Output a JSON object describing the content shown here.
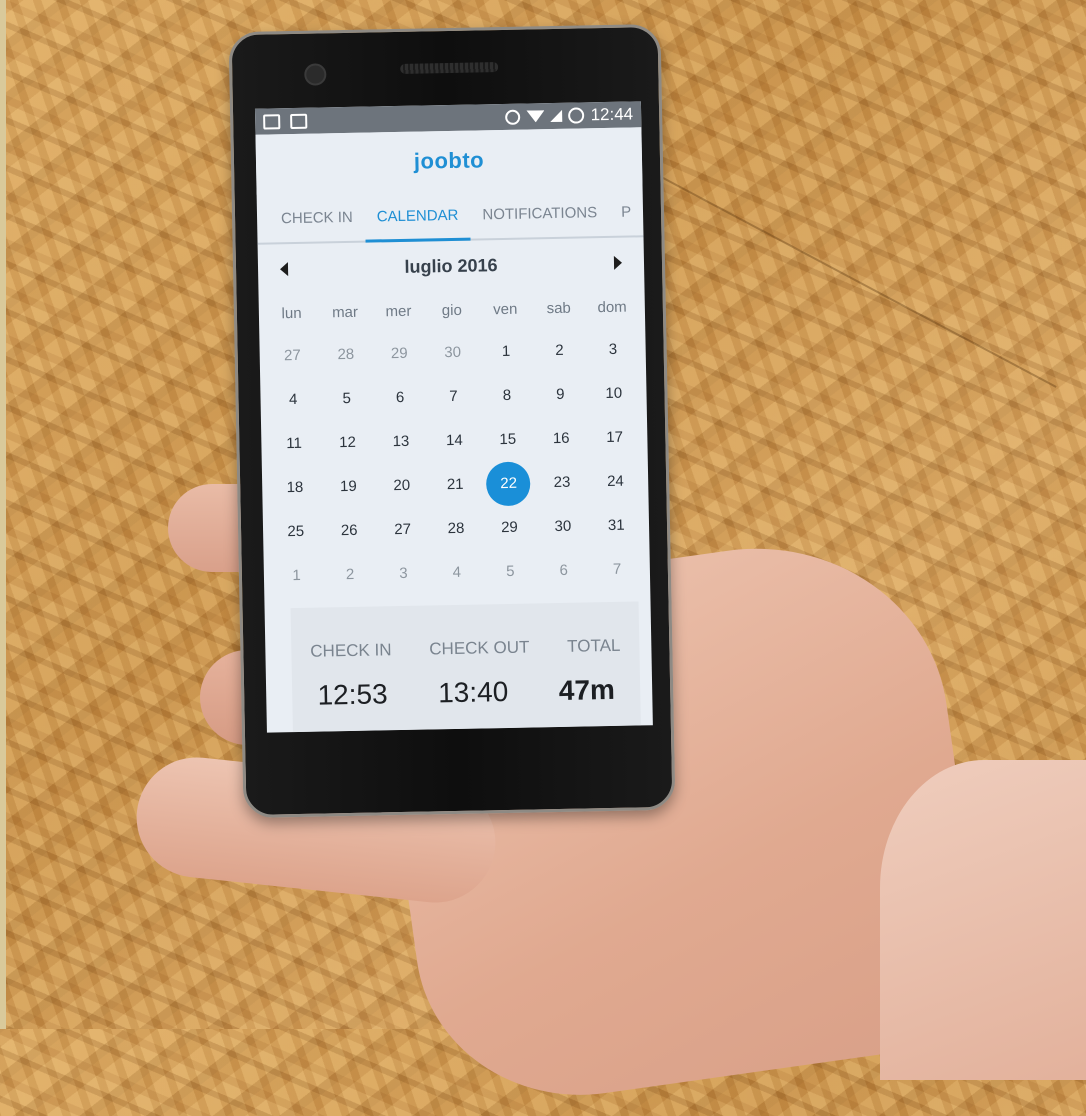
{
  "status_bar": {
    "time": "12:44",
    "icons": [
      "image-icon",
      "camera-icon",
      "alarm-icon",
      "wifi-icon",
      "signal-icon",
      "sync-icon"
    ]
  },
  "app": {
    "logo": "joobto"
  },
  "tabs": [
    {
      "label": "CHECK IN",
      "active": false
    },
    {
      "label": "CALENDAR",
      "active": true
    },
    {
      "label": "NOTIFICATIONS",
      "active": false
    },
    {
      "label": "P",
      "active": false
    }
  ],
  "calendar": {
    "month_title": "luglio 2016",
    "weekdays": [
      "lun",
      "mar",
      "mer",
      "gio",
      "ven",
      "sab",
      "dom"
    ],
    "weeks": [
      [
        "27",
        "28",
        "29",
        "30",
        "1",
        "2",
        "3"
      ],
      [
        "4",
        "5",
        "6",
        "7",
        "8",
        "9",
        "10"
      ],
      [
        "11",
        "12",
        "13",
        "14",
        "15",
        "16",
        "17"
      ],
      [
        "18",
        "19",
        "20",
        "21",
        "22",
        "23",
        "24"
      ],
      [
        "25",
        "26",
        "27",
        "28",
        "29",
        "30",
        "31"
      ],
      [
        "1",
        "2",
        "3",
        "4",
        "5",
        "6",
        "7"
      ]
    ],
    "selected_day": "22",
    "accent_color": "#1a8fd8"
  },
  "summary": {
    "check_in_label": "CHECK IN",
    "check_out_label": "CHECK OUT",
    "total_label": "TOTAL",
    "check_in_value": "12:53",
    "check_out_value": "13:40",
    "total_value": "47m"
  }
}
